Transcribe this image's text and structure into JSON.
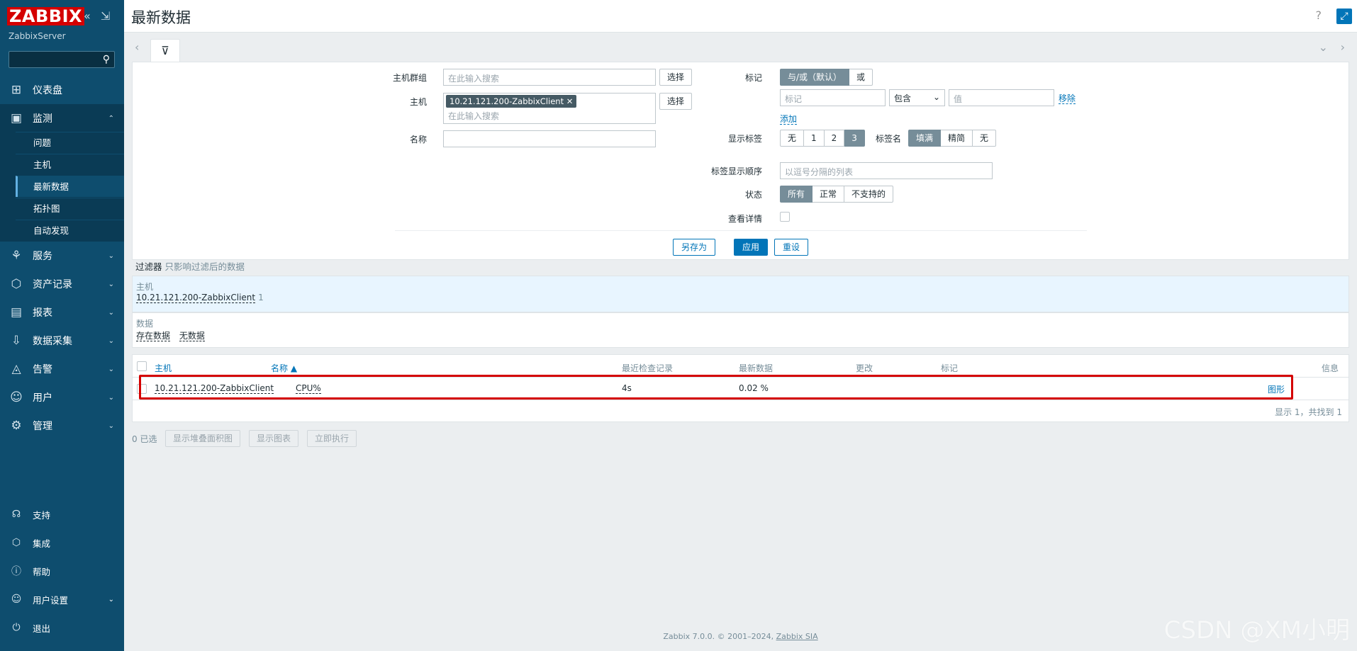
{
  "brand": {
    "logo_text": "ZABBIX",
    "server_name": "ZabbixServer"
  },
  "sidebar": {
    "nav": [
      {
        "label": "仪表盘",
        "icon": "dashboard-icon"
      },
      {
        "label": "监测",
        "icon": "monitoring-icon"
      },
      {
        "label": "服务",
        "icon": "services-icon"
      },
      {
        "label": "资产记录",
        "icon": "inventory-icon"
      },
      {
        "label": "报表",
        "icon": "reports-icon"
      },
      {
        "label": "数据采集",
        "icon": "data-collection-icon"
      },
      {
        "label": "告警",
        "icon": "alerts-icon"
      },
      {
        "label": "用户",
        "icon": "users-icon"
      },
      {
        "label": "管理",
        "icon": "administration-icon"
      }
    ],
    "monitoring_sub": [
      "问题",
      "主机",
      "最新数据",
      "拓扑图",
      "自动发现"
    ],
    "bottom": [
      {
        "label": "支持",
        "icon": "headset-icon"
      },
      {
        "label": "集成",
        "icon": "integrations-icon"
      },
      {
        "label": "帮助",
        "icon": "help-icon"
      },
      {
        "label": "用户设置",
        "icon": "user-settings-icon"
      },
      {
        "label": "退出",
        "icon": "power-icon"
      }
    ]
  },
  "header": {
    "title": "最新数据",
    "help_glyph": "?"
  },
  "filter": {
    "hostgroups_label": "主机群组",
    "hostgroups_placeholder": "在此输入搜索",
    "select_label": "选择",
    "hosts_label": "主机",
    "host_chip": "10.21.121.200-ZabbixClient",
    "hosts_placeholder": "在此输入搜索",
    "name_label": "名称",
    "tags_label": "标记",
    "tags_mode": [
      "与/或（默认）",
      "或"
    ],
    "tag_placeholder": "标记",
    "tag_operator": "包含",
    "tag_value_placeholder": "值",
    "remove_label": "移除",
    "add_label": "添加",
    "show_tags_label": "显示标签",
    "show_tags_options": [
      "无",
      "1",
      "2",
      "3"
    ],
    "tag_name_label": "标签名",
    "tag_name_options": [
      "填满",
      "精简",
      "无"
    ],
    "tag_priority_label": "标签显示顺序",
    "tag_priority_placeholder": "以逗号分隔的列表",
    "state_label": "状态",
    "state_options": [
      "所有",
      "正常",
      "不支持的"
    ],
    "details_label": "查看详情",
    "save_as": "另存为",
    "apply": "应用",
    "reset": "重设"
  },
  "subfilter": {
    "title": "过滤器",
    "hint": "只影响过滤后的数据",
    "hosts_head": "主机",
    "host_value": "10.21.121.200-ZabbixClient",
    "host_count": "1",
    "data_head": "数据",
    "data_values": [
      "存在数据",
      "无数据"
    ]
  },
  "table": {
    "columns": [
      "主机",
      "名称 ▲",
      "最近检查记录",
      "最新数据",
      "更改",
      "标记",
      "信息"
    ],
    "rows": [
      {
        "host": "10.21.121.200-ZabbixClient",
        "name": "CPU%",
        "last_check": "4s",
        "last_value": "0.02 %",
        "change": "",
        "tags": "",
        "action": "图形"
      }
    ],
    "paging": "显示 1，共找到 1"
  },
  "bulk": {
    "selected": "0 已选",
    "buttons": [
      "显示堆叠面积图",
      "显示图表",
      "立即执行"
    ]
  },
  "footer": {
    "text": "Zabbix 7.0.0. © 2001–2024, ",
    "company": "Zabbix SIA"
  },
  "watermark": "CSDN @XM小明"
}
